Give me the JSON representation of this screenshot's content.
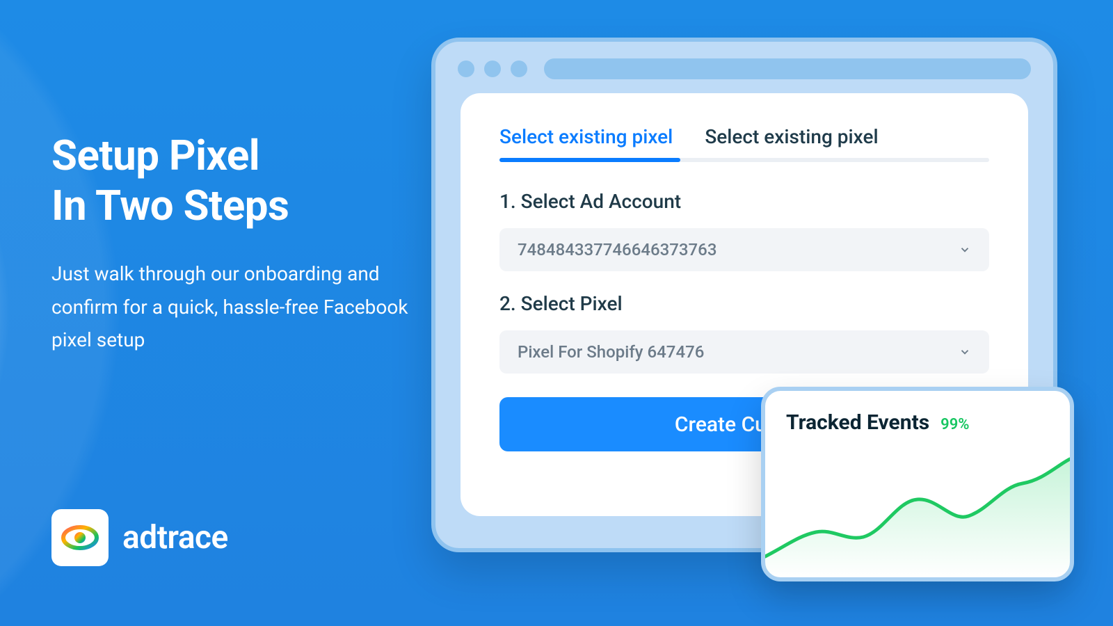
{
  "hero": {
    "title_line1": "Setup Pixel",
    "title_line2": "In Two Steps",
    "subtitle": "Just walk through our onboarding and confirm for a quick, hassle-free Facebook pixel setup"
  },
  "brand": {
    "name": "adtrace"
  },
  "window": {
    "tabs": [
      {
        "label": "Select existing pixel",
        "active": true
      },
      {
        "label": "Select existing pixel",
        "active": false
      }
    ],
    "step1": {
      "label": "1. Select Ad Account",
      "value": "748484337746646373763"
    },
    "step2": {
      "label": "2. Select Pixel",
      "value": "Pixel For Shopify 647476"
    },
    "cta": "Create Custom"
  },
  "events_card": {
    "title": "Tracked Events",
    "percent": "99%"
  }
}
